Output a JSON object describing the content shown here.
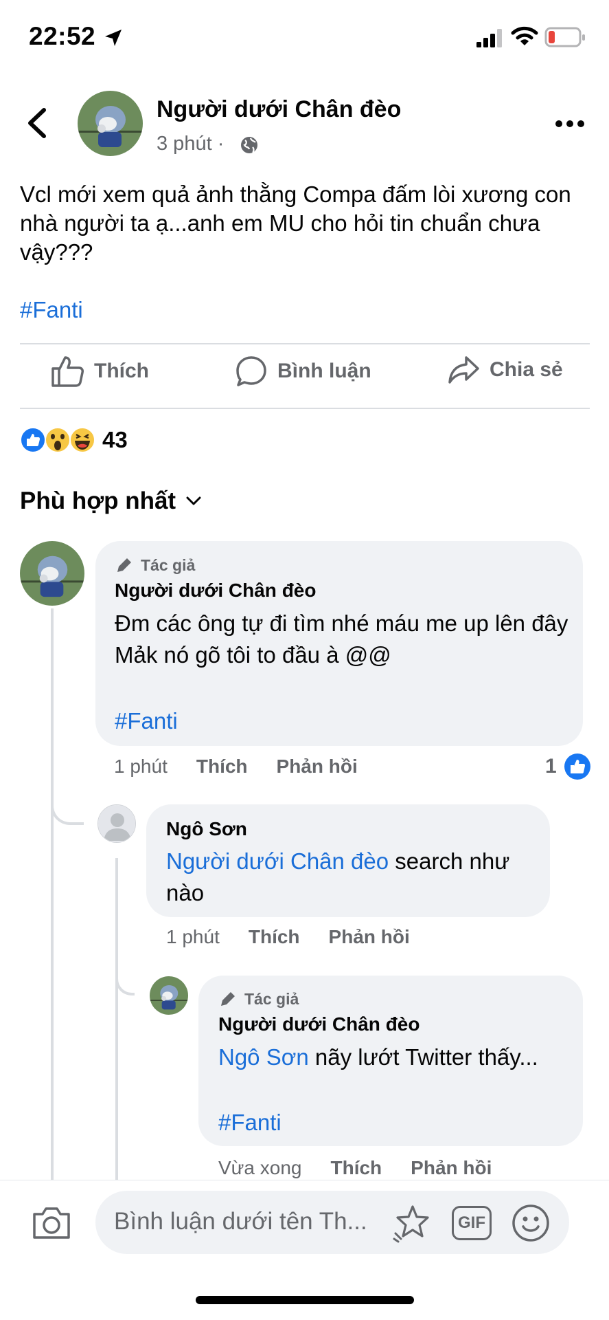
{
  "status_bar": {
    "time": "22:52"
  },
  "post": {
    "author": "Người dưới Chân đèo",
    "time": "3 phút",
    "separator": "·",
    "text": "Vcl mới xem quả ảnh thằng Compa đấm lòi xương con nhà người ta ạ...anh em MU cho hỏi tin chuẩn chưa vậy???",
    "hashtag": "#Fanti"
  },
  "actions": {
    "like": "Thích",
    "comment": "Bình luận",
    "share": "Chia sẻ"
  },
  "reactions": {
    "count": "43",
    "icons": [
      "like-icon",
      "wow-icon",
      "haha-icon"
    ]
  },
  "sort": {
    "label": "Phù hợp nhất"
  },
  "comments": [
    {
      "badge": "Tác giả",
      "author": "Người dưới Chân đèo",
      "text": "Đm các ông tự đi tìm nhé máu me up lên đây Mảk nó gõ tôi to đầu à @@",
      "hashtag": "#Fanti",
      "time": "1 phút",
      "like": "Thích",
      "reply": "Phản hồi",
      "like_count": "1"
    },
    {
      "author": "Ngô Sơn",
      "mention": "Người dưới Chân đèo",
      "text": " search như nào",
      "time": "1 phút",
      "like": "Thích",
      "reply": "Phản hồi"
    },
    {
      "badge": "Tác giả",
      "author": "Người dưới Chân đèo",
      "mention": "Ngô Sơn",
      "text": " nãy lướt Twitter thấy...",
      "hashtag": "#Fanti",
      "time": "Vừa xong",
      "like": "Thích",
      "reply": "Phản hồi"
    }
  ],
  "composer": {
    "placeholder": "Bình luận dưới tên Th...",
    "gif_label": "GIF"
  },
  "colors": {
    "accent": "#1a6ed8",
    "like_blue": "#1877f2",
    "bubble": "#f0f2f5",
    "secondary_text": "#65676b"
  }
}
